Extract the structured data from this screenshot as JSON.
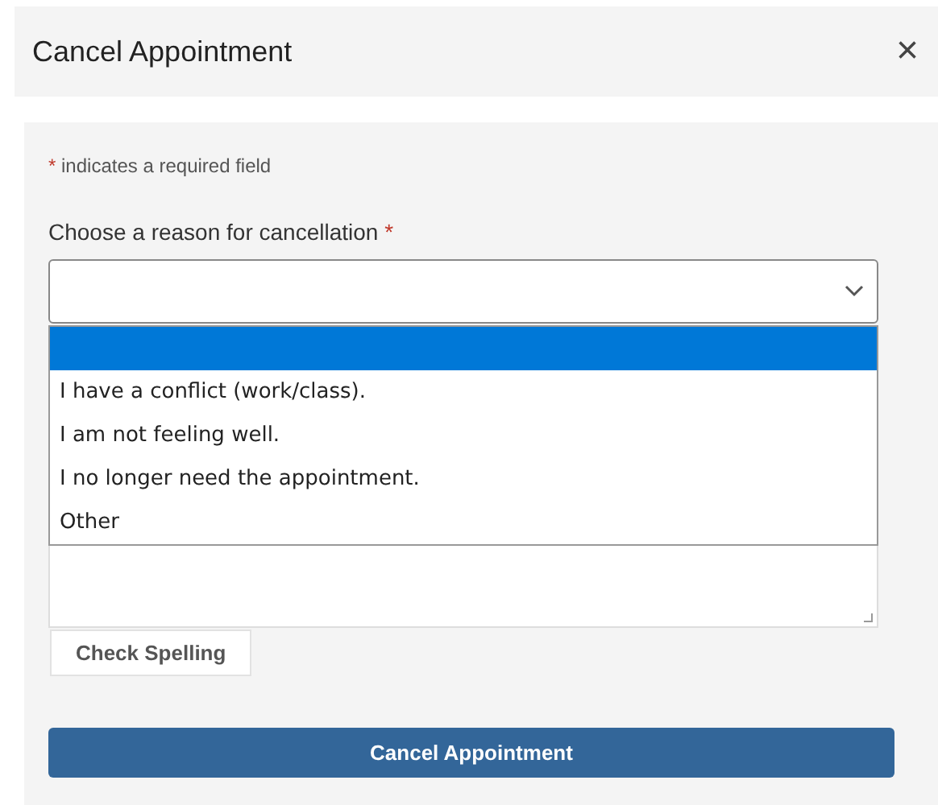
{
  "dialog": {
    "title": "Cancel Appointment",
    "close": "×"
  },
  "form": {
    "required_note": {
      "mark": "*",
      "text": "indicates a required field"
    },
    "reason": {
      "label": "Choose a reason for cancellation",
      "mark": "*",
      "expanded": true,
      "options": [
        {
          "selected": true
        },
        {
          "label": "I have a conflict (work/class).",
          "selected": false
        },
        {
          "label": "I am not feeling well.",
          "selected": false
        },
        {
          "label": "I no longer need the appointment.",
          "selected": false
        },
        {
          "label": "Other",
          "selected": false
        }
      ]
    },
    "spell_button": "Check Spelling",
    "submit_button": "Cancel Appointment"
  }
}
